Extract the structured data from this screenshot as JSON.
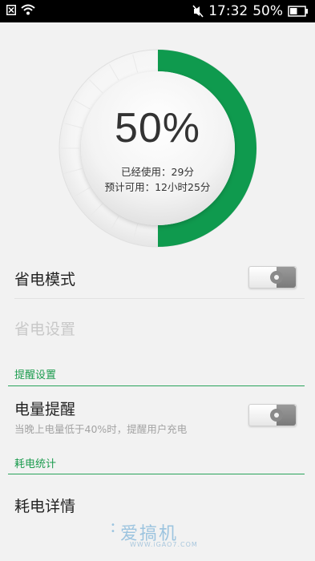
{
  "status_bar": {
    "time": "17:32",
    "battery_percent": "50%",
    "icons": [
      "close-box-icon",
      "wifi-icon",
      "mute-icon",
      "battery-icon"
    ]
  },
  "battery": {
    "percent_label": "50%",
    "level": 0.5,
    "used_text": "已经使用：29分",
    "available_text": "预计可用：12小时25分",
    "accent_color": "#0f9a4e"
  },
  "settings": {
    "power_saving_mode": {
      "label": "省电模式",
      "enabled": false
    },
    "power_saving_settings": {
      "label": "省电设置",
      "disabled": true
    }
  },
  "reminder_section": {
    "header": "提醒设置",
    "battery_reminder": {
      "label": "电量提醒",
      "description": "当晚上电量低于40%时，提醒用户充电",
      "enabled": false
    }
  },
  "consumption_section": {
    "header": "耗电统计",
    "details_label": "耗电详情"
  },
  "watermark": {
    "text": "爱搞机",
    "url": "WWW.iGAO7.COM"
  }
}
